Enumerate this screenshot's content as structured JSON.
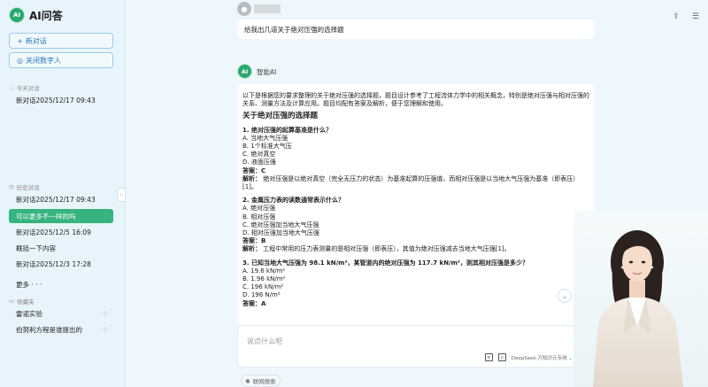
{
  "app": {
    "title": "AI问答",
    "logo_text": "AI"
  },
  "sidebar": {
    "new_chat_label": "新对话",
    "digital_human_label": "关闭数字人",
    "today_label": "今天对话",
    "today_items": [
      {
        "label": "新对话2025/12/17 09:43"
      }
    ],
    "history_label": "历史对话",
    "history_items": [
      {
        "label": "新对话2025/12/17 09:43",
        "active": false
      },
      {
        "label": "可以更多不一样的吗",
        "active": true
      },
      {
        "label": "新对话2025/12/5 16:09",
        "active": false
      },
      {
        "label": "概括一下内容",
        "active": false
      },
      {
        "label": "新对话2025/12/3 17:28",
        "active": false
      }
    ],
    "more_label": "更多 · · ·",
    "favorites_label": "收藏夹",
    "favorite_items": [
      {
        "label": "雷诺实验"
      },
      {
        "label": "伯努利方程是谁提出的"
      }
    ]
  },
  "chat": {
    "user_message": "给我出几道关于绝对压强的选择题",
    "ai_name": "智能AI",
    "ai_avatar_text": "AI",
    "intro": "以下是根据您的要求整理的关于绝对压强的选择题，题目设计参考了工程流体力学中的相关概念，特别是绝对压强与相对压强的关系、测量方法及计算应用。题目均配有答案及解析，便于您理解和使用。",
    "heading": "关于绝对压强的选择题",
    "questions": [
      {
        "q": "1. 绝对压强的起算基准是什么？",
        "options": [
          "A. 当地大气压强",
          "B. 1个标准大气压",
          "C. 绝对真空",
          "D. 液面压强"
        ],
        "answer_label": "答案：",
        "answer": "C",
        "analysis_label": "解析：",
        "analysis": "绝对压强是以绝对真空（完全无压力的状态）为基准起算的压强值，而相对压强是以当地大气压强为基准（即表压）[1]。"
      },
      {
        "q": "2. 金属压力表的读数通常表示什么？",
        "options": [
          "A. 绝对压强",
          "B. 相对压强",
          "C. 绝对压强加当地大气压强",
          "D. 相对压强加当地大气压强"
        ],
        "answer_label": "答案：",
        "answer": "B",
        "analysis_label": "解析：",
        "analysis": "工程中常用的压力表测量的是相对压强（即表压），其值为绝对压强减去当地大气压强[1]。"
      },
      {
        "q": "3. 已知当地大气压强为 98.1 kN/m²，某管道内的绝对压强为 117.7 kN/m²，则其相对压强是多少？",
        "options": [
          "A. 19.6 kN/m²",
          "B. 1.96 kN/m²",
          "C. 196 kN/m²",
          "D. 196 N/m²"
        ],
        "answer_label": "答案：",
        "answer": "A"
      }
    ]
  },
  "input": {
    "placeholder": "说点什么吧",
    "model_label": "DeepSeek-万知识元专线",
    "net_search_label": "联网搜索"
  }
}
